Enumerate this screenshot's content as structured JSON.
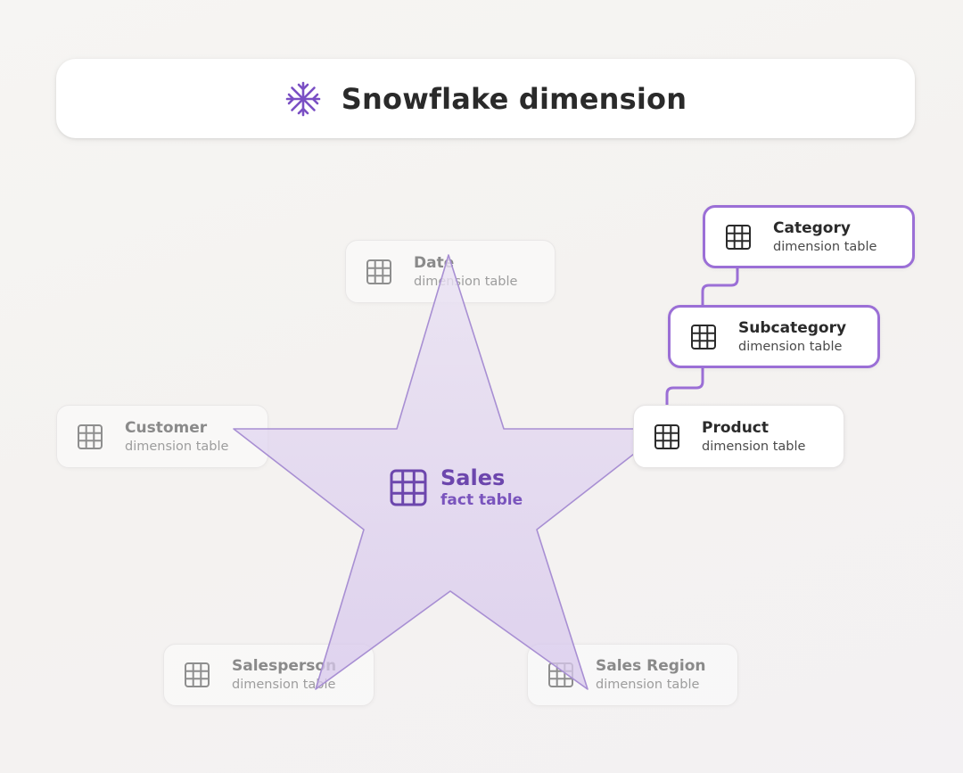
{
  "header": {
    "icon": "snowflake-icon",
    "title": "Snowflake dimension"
  },
  "colors": {
    "accent": "#9b6fd6",
    "fact_text": "#6c46ad",
    "star_fill": "#e3d6f1",
    "star_stroke": "#a88fd3"
  },
  "fact": {
    "icon": "table-icon",
    "title": "Sales",
    "subtitle": "fact table"
  },
  "dimensions": {
    "date": {
      "title": "Date",
      "subtitle": "dimension table"
    },
    "customer": {
      "title": "Customer",
      "subtitle": "dimension table"
    },
    "salesperson": {
      "title": "Salesperson",
      "subtitle": "dimension table"
    },
    "sales_region": {
      "title": "Sales Region",
      "subtitle": "dimension table"
    },
    "product": {
      "title": "Product",
      "subtitle": "dimension table"
    },
    "subcategory": {
      "title": "Subcategory",
      "subtitle": "dimension table"
    },
    "category": {
      "title": "Category",
      "subtitle": "dimension table"
    }
  }
}
